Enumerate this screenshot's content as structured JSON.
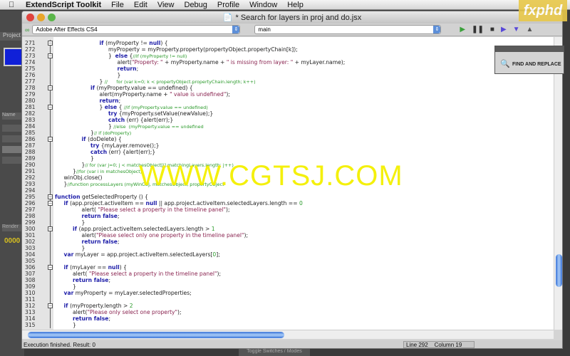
{
  "menubar": {
    "app": "ExtendScript Toolkit",
    "items": [
      "File",
      "Edit",
      "View",
      "Debug",
      "Profile",
      "Window",
      "Help"
    ]
  },
  "logo": "fxphd",
  "watermark": "WWW.CGTSJ.COM",
  "ae_panel": {
    "project_tab": "Project",
    "name_col": "Name",
    "render_tab": "Render",
    "timecode": "0000",
    "bottom_tab": "Toggle Switches / Modes"
  },
  "window": {
    "title": "* Search for layers in proj and do.jsx"
  },
  "toolbar": {
    "target_app": "Adobe After Effects CS4",
    "function": "main"
  },
  "find_panel": {
    "label": "FIND AND REPLACE"
  },
  "status": {
    "message": "Execution finished. Result: 0",
    "line": "Line 292",
    "column": "Column 19"
  },
  "colors": {
    "keyword": "#1c1ca8",
    "string": "#8a2450",
    "comment": "#2a9a2a",
    "watermark": "#f4f000",
    "scroll_thumb": "#3b74d8"
  },
  "code": [
    {
      "n": "271",
      "i": 5,
      "f": "box",
      "t": [
        [
          "kw",
          "if"
        ],
        [
          "",
          "(myProperty != "
        ],
        [
          "kw",
          "null"
        ],
        [
          "",
          ") {"
        ]
      ]
    },
    {
      "n": "272",
      "i": 6,
      "t": [
        [
          "",
          "myProperty = myProperty.property(propertyObject.propertyChain[k]);"
        ]
      ]
    },
    {
      "n": "273",
      "i": 6,
      "f": "box",
      "t": [
        [
          "",
          "}  "
        ],
        [
          "kw",
          "else"
        ],
        [
          "",
          " {"
        ],
        [
          "cm",
          "//if (myProperty != null)"
        ]
      ]
    },
    {
      "n": "274",
      "i": 7,
      "t": [
        [
          "",
          "alert("
        ],
        [
          "str",
          "\"Property: \""
        ],
        [
          "",
          " + myProperty.name + "
        ],
        [
          "str",
          "\" is missing from layer: \""
        ],
        [
          "",
          " + myLayer.name);"
        ]
      ]
    },
    {
      "n": "275",
      "i": 7,
      "t": [
        [
          "kw",
          "return"
        ],
        [
          "",
          ";"
        ]
      ]
    },
    {
      "n": "276",
      "i": 7,
      "f": "end",
      "t": [
        [
          "",
          "}"
        ]
      ]
    },
    {
      "n": "277",
      "i": 5,
      "f": "end",
      "t": [
        [
          "",
          "} "
        ],
        [
          "cm",
          "//      for (var k=0; k < propertyObject.propertyChain.length; k++)"
        ]
      ]
    },
    {
      "n": "278",
      "i": 4,
      "f": "box",
      "t": [
        [
          "kw",
          "if"
        ],
        [
          "",
          "(myProperty.value == undefined) {"
        ]
      ]
    },
    {
      "n": "279",
      "i": 5,
      "t": [
        [
          "",
          "alert(myProperty.name + "
        ],
        [
          "str",
          "\" value is undefined\""
        ],
        [
          "",
          ");"
        ]
      ]
    },
    {
      "n": "280",
      "i": 5,
      "t": [
        [
          "kw",
          "return"
        ],
        [
          "",
          ";"
        ]
      ]
    },
    {
      "n": "281",
      "i": 5,
      "f": "box",
      "t": [
        [
          "",
          "} "
        ],
        [
          "kw",
          "else"
        ],
        [
          "",
          " { "
        ],
        [
          "cm",
          "//if (myProperty.value == undefined)"
        ]
      ]
    },
    {
      "n": "282",
      "i": 6,
      "t": [
        [
          "kw",
          "try"
        ],
        [
          "",
          " {myProperty.setValue(newValue);}"
        ]
      ]
    },
    {
      "n": "283",
      "i": 6,
      "t": [
        [
          "kw",
          "catch"
        ],
        [
          "",
          " (err) {alert(err);}"
        ]
      ]
    },
    {
      "n": "284",
      "i": 6,
      "f": "end",
      "t": [
        [
          "",
          "} "
        ],
        [
          "cm",
          "//else  (myProperty.value == undefined"
        ]
      ]
    },
    {
      "n": "285",
      "i": 4,
      "f": "end",
      "t": [
        [
          "",
          "}"
        ],
        [
          "cm",
          "// if (doProperty)"
        ]
      ]
    },
    {
      "n": "286",
      "i": 3,
      "f": "box",
      "t": [
        [
          "kw",
          "if"
        ],
        [
          "",
          "(doDelete) {"
        ]
      ]
    },
    {
      "n": "287",
      "i": 4,
      "t": [
        [
          "kw",
          "try"
        ],
        [
          "",
          " {myLayer.remove();}"
        ]
      ]
    },
    {
      "n": "288",
      "i": 4,
      "t": [
        [
          "kw",
          "catch"
        ],
        [
          "",
          " (err) {alert(err);}"
        ]
      ]
    },
    {
      "n": "289",
      "i": 4,
      "f": "end",
      "t": [
        [
          "",
          "}"
        ]
      ]
    },
    {
      "n": "290",
      "i": 3,
      "f": "end",
      "t": [
        [
          "",
          "}"
        ],
        [
          "cm",
          "// for (var j=0; j < matchesObject[i].matchingLayers.length; j++)"
        ]
      ]
    },
    {
      "n": "291",
      "i": 2,
      "f": "end",
      "t": [
        [
          "",
          "}"
        ],
        [
          "cm",
          "//for (var i in matchesObject)"
        ]
      ]
    },
    {
      "n": "292",
      "i": 1,
      "t": [
        [
          "",
          "winObj.close()"
        ]
      ]
    },
    {
      "n": "293",
      "i": 1,
      "f": "end",
      "t": [
        [
          "",
          "}"
        ],
        [
          "cm",
          "//function processLayers (myWinObj, matchesObject, propertyObject"
        ]
      ]
    },
    {
      "n": "294",
      "i": 0,
      "t": []
    },
    {
      "n": "295",
      "i": 0,
      "f": "box",
      "t": [
        [
          "kw",
          "function"
        ],
        [
          "",
          " getSelectedProperty () {"
        ]
      ]
    },
    {
      "n": "296",
      "i": 1,
      "f": "box",
      "t": [
        [
          "kw",
          "if"
        ],
        [
          "",
          "(app.project.activeItem == "
        ],
        [
          "kw",
          "null"
        ],
        [
          "",
          " || app.project.activeItem.selectedLayers.length == "
        ],
        [
          "num",
          "0"
        ],
        [
          ") {"
        ]
      ]
    },
    {
      "n": "297",
      "i": 3,
      "t": [
        [
          "",
          "alert( "
        ],
        [
          "str",
          "\"Please select a property in the timeline panel\""
        ],
        [
          "",
          ");"
        ]
      ]
    },
    {
      "n": "298",
      "i": 3,
      "t": [
        [
          "kw",
          "return false"
        ],
        [
          "",
          ";"
        ]
      ]
    },
    {
      "n": "299",
      "i": 3,
      "f": "end",
      "t": [
        [
          "",
          "}"
        ]
      ]
    },
    {
      "n": "300",
      "i": 2,
      "f": "box",
      "t": [
        [
          "kw",
          "if"
        ],
        [
          "",
          "(app.project.activeItem.selectedLayers.length > "
        ],
        [
          "num",
          "1"
        ],
        [
          ") {"
        ]
      ]
    },
    {
      "n": "301",
      "i": 3,
      "t": [
        [
          "",
          "alert("
        ],
        [
          "str",
          "\"Please select only one property in the timeline panel\""
        ],
        [
          "",
          ");"
        ]
      ]
    },
    {
      "n": "302",
      "i": 3,
      "t": [
        [
          "kw",
          "return false"
        ],
        [
          "",
          ";"
        ]
      ]
    },
    {
      "n": "303",
      "i": 3,
      "f": "end",
      "t": [
        [
          "",
          "}"
        ]
      ]
    },
    {
      "n": "304",
      "i": 1,
      "t": [
        [
          "kw",
          "var"
        ],
        [
          "",
          " myLayer = app.project.activeItem.selectedLayers["
        ],
        [
          "num",
          "0"
        ],
        [
          "",
          "];"
        ]
      ]
    },
    {
      "n": "305",
      "i": 0,
      "t": []
    },
    {
      "n": "306",
      "i": 1,
      "f": "box",
      "t": [
        [
          "kw",
          "if"
        ],
        [
          "",
          "(myLayer == "
        ],
        [
          "kw",
          "null"
        ],
        [
          "",
          ") {"
        ]
      ]
    },
    {
      "n": "307",
      "i": 2,
      "t": [
        [
          "",
          "alert( "
        ],
        [
          "str",
          "\"Please select a property in the timeline panel\""
        ],
        [
          "",
          ");"
        ]
      ]
    },
    {
      "n": "308",
      "i": 2,
      "t": [
        [
          "kw",
          "return false"
        ],
        [
          "",
          ";"
        ]
      ]
    },
    {
      "n": "309",
      "i": 2,
      "f": "end",
      "t": [
        [
          "",
          "}"
        ]
      ]
    },
    {
      "n": "310",
      "i": 1,
      "t": [
        [
          "kw",
          "var"
        ],
        [
          "",
          " myProperty = myLayer.selectedProperties;"
        ]
      ]
    },
    {
      "n": "311",
      "i": 0,
      "t": []
    },
    {
      "n": "312",
      "i": 1,
      "f": "box",
      "t": [
        [
          "kw",
          "if"
        ],
        [
          "",
          "(myProperty.length > "
        ],
        [
          "num",
          "2"
        ],
        [
          ") {"
        ]
      ]
    },
    {
      "n": "313",
      "i": 2,
      "t": [
        [
          "",
          "alert("
        ],
        [
          "str",
          "\"Please only select one property\""
        ],
        [
          "",
          ");"
        ]
      ]
    },
    {
      "n": "314",
      "i": 2,
      "t": [
        [
          "kw",
          "return false"
        ],
        [
          "",
          ";"
        ]
      ]
    },
    {
      "n": "315",
      "i": 2,
      "f": "end",
      "t": [
        [
          "",
          "}"
        ]
      ]
    }
  ]
}
